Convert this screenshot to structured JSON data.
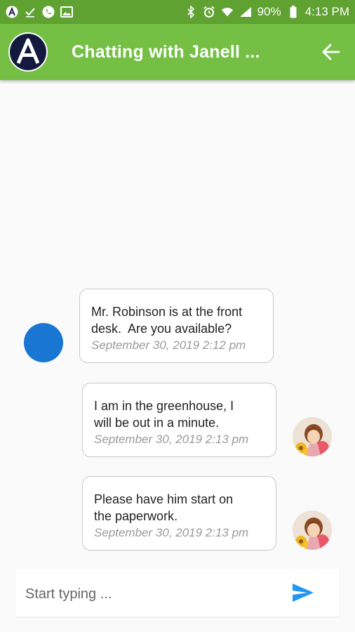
{
  "status_bar": {
    "battery": "90%",
    "time": "4:13 PM"
  },
  "header": {
    "title": "Chatting with Janell ..."
  },
  "messages": [
    {
      "text": "Mr. Robinson is at the front\ndesk.  Are you available?",
      "time": "September 30, 2019 2:12 pm",
      "sender": "other"
    },
    {
      "text": "I am in the greenhouse, I\nwill be out in a minute.",
      "time": "September 30, 2019 2:13 pm",
      "sender": "me"
    },
    {
      "text": "Please have him start on\nthe paperwork.",
      "time": "September 30, 2019 2:13 pm",
      "sender": "me"
    }
  ],
  "composer": {
    "placeholder": "Start typing ..."
  },
  "colors": {
    "status_bar": "#5fa232",
    "app_bar": "#74bf44",
    "sender_avatar": "#1976d2",
    "send_icon": "#2196f3"
  }
}
